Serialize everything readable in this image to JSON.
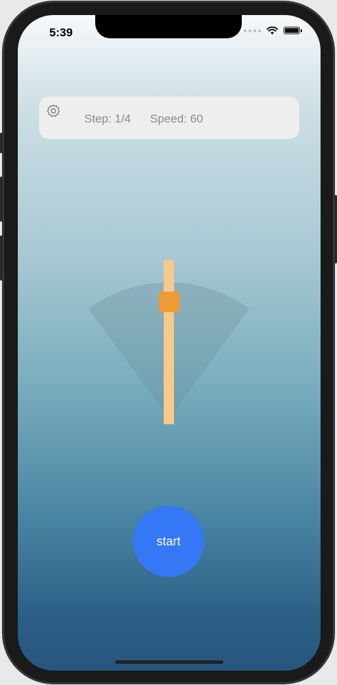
{
  "status_bar": {
    "time": "5:39"
  },
  "info_bar": {
    "step_text": "Step: 1/4",
    "speed_text": "Speed: 60",
    "settings_icon": "gear-icon"
  },
  "gauge": {
    "slider_level": 0.78,
    "track_color": "#f7c98a",
    "thumb_color": "#ef9a34",
    "sector_color": "#6a8e9c"
  },
  "start_button": {
    "label": "start",
    "color": "#3478f6"
  }
}
